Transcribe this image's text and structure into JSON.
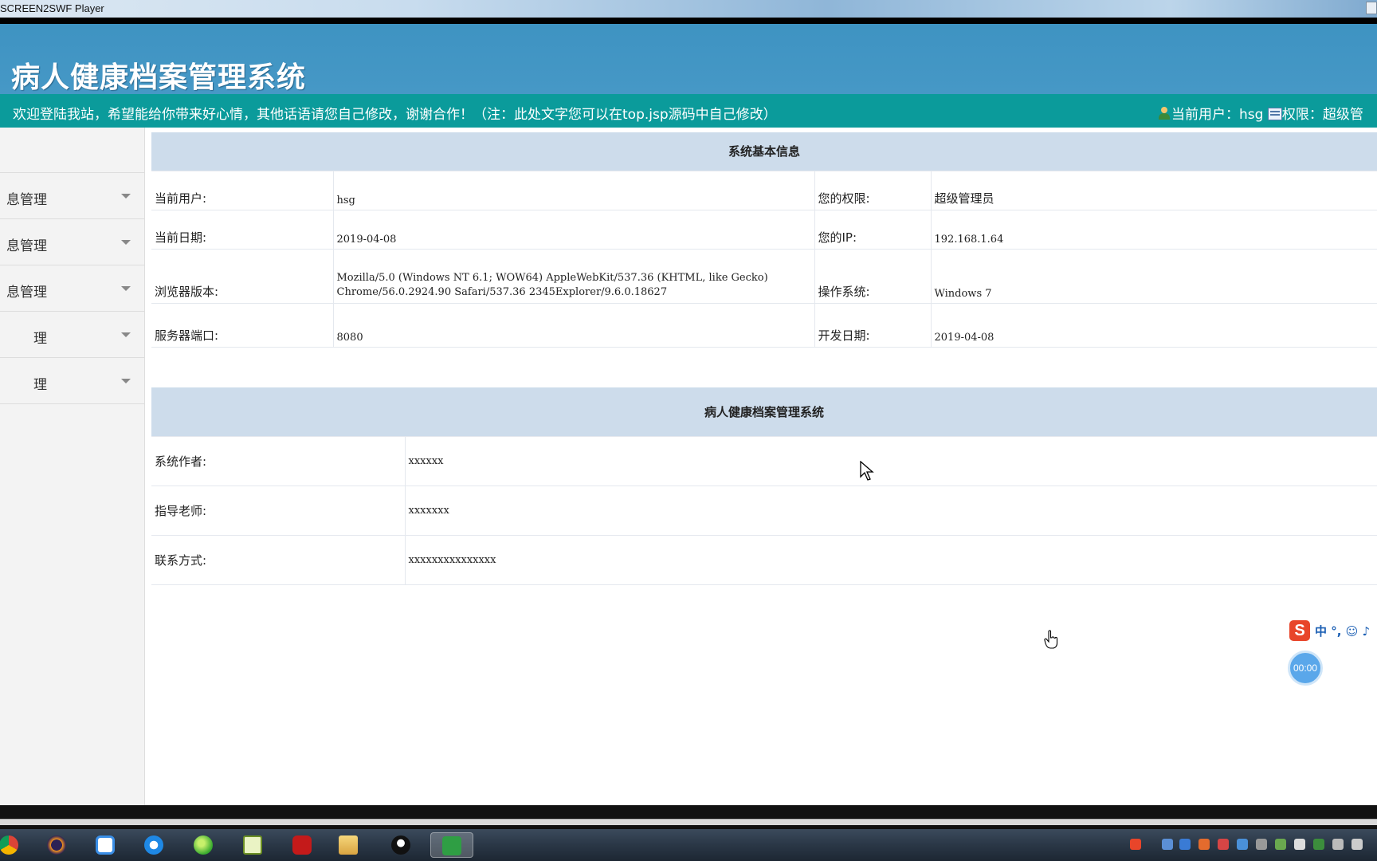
{
  "window": {
    "title": "SCREEN2SWF Player"
  },
  "header": {
    "app_title": "病人健康档案管理系统",
    "welcome": "欢迎登陆我站，希望能给你带来好心情，其他话语请您自己修改，谢谢合作！（注：此处文字您可以在top.jsp源码中自己修改）",
    "user_label": "当前用户：hsg",
    "perm_label": "权限：超级管"
  },
  "sidebar": {
    "items": [
      {
        "label": "息管理"
      },
      {
        "label": "息管理"
      },
      {
        "label": "息管理"
      },
      {
        "label": "理"
      },
      {
        "label": "理"
      }
    ]
  },
  "system_info": {
    "heading": "系统基本信息",
    "rows": [
      {
        "l1": "当前用户:",
        "v1": "hsg",
        "l2": "您的权限:",
        "v2": "超级管理员"
      },
      {
        "l1": "当前日期:",
        "v1": "2019-04-08",
        "l2": "您的IP:",
        "v2": "192.168.1.64"
      },
      {
        "l1": "浏览器版本:",
        "v1": "Mozilla/5.0 (Windows NT 6.1; WOW64) AppleWebKit/537.36 (KHTML, like Gecko) Chrome/56.0.2924.90 Safari/537.36 2345Explorer/9.6.0.18627",
        "l2": "操作系统:",
        "v2": "Windows 7"
      },
      {
        "l1": "服务器端口:",
        "v1": "8080",
        "l2": "开发日期:",
        "v2": "2019-04-08"
      }
    ]
  },
  "author_info": {
    "heading": "病人健康档案管理系统",
    "rows": [
      {
        "label": "系统作者:",
        "value": "xxxxxx"
      },
      {
        "label": "指导老师:",
        "value": "xxxxxxx"
      },
      {
        "label": "联系方式:",
        "value": "xxxxxxxxxxxxxxx"
      }
    ]
  },
  "ime": {
    "logo": "S",
    "text": "中 °, ☺ ♪"
  },
  "timer": {
    "value": "00:00"
  },
  "taskbar": {
    "icons": [
      "chrome-icon",
      "eclipse-icon",
      "baidu-netdisk-icon",
      "browser-icon",
      "360-icon",
      "notepad-icon",
      "flash-icon",
      "file-explorer-icon",
      "qq-icon",
      "screen2swf-icon"
    ]
  },
  "colors": {
    "header_blue": "#4698c6",
    "subbar_teal": "#0b9b9b",
    "table_head": "#cddceb"
  }
}
